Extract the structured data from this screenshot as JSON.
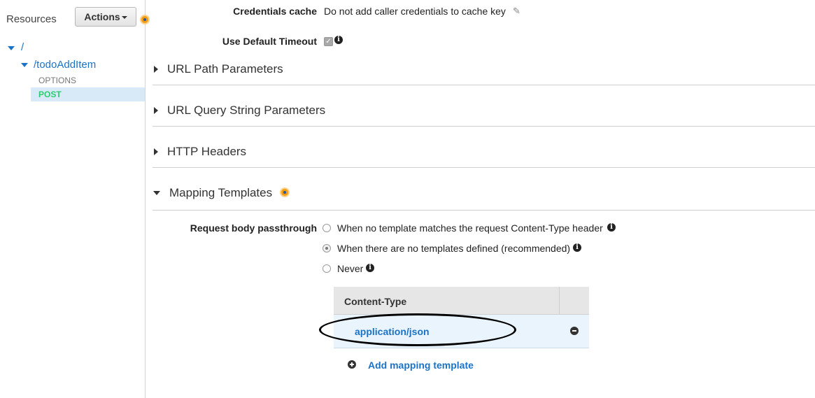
{
  "sidebar": {
    "title": "Resources",
    "actions_label": "Actions",
    "tree": {
      "root": "/",
      "resource": "/todoAddItem",
      "methods": [
        "OPTIONS",
        "POST"
      ]
    }
  },
  "main": {
    "credentials_cache": {
      "label": "Credentials cache",
      "value": "Do not add caller credentials to cache key"
    },
    "default_timeout": {
      "label": "Use Default Timeout",
      "checked": true
    },
    "sections": [
      {
        "title": "URL Path Parameters",
        "expanded": false
      },
      {
        "title": "URL Query String Parameters",
        "expanded": false
      },
      {
        "title": "HTTP Headers",
        "expanded": false
      },
      {
        "title": "Mapping Templates",
        "expanded": true
      }
    ],
    "passthrough": {
      "label": "Request body passthrough",
      "options": [
        "When no template matches the request Content-Type header",
        "When there are no templates defined (recommended)",
        "Never"
      ],
      "selected_index": 1
    },
    "content_table": {
      "header": "Content-Type",
      "rows": [
        "application/json"
      ]
    },
    "add_template_label": "Add mapping template"
  },
  "colors": {
    "accent": "#1a73c7",
    "post": "#2ecc71",
    "highlight": "#f39c12"
  }
}
